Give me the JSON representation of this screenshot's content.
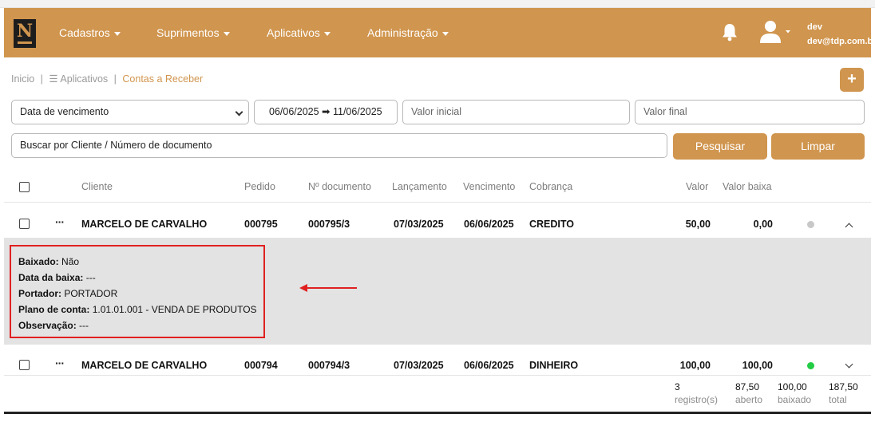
{
  "brand": {
    "logo_text": "N",
    "color": "#d0954e"
  },
  "nav": {
    "menus": [
      "Cadastros",
      "Suprimentos",
      "Aplicativos",
      "Administração"
    ],
    "user_name": "dev",
    "user_email": "dev@tdp.com.br",
    "icons": [
      "bell-icon",
      "user-icon"
    ]
  },
  "breadcrumb": {
    "home": "Inicio",
    "sep": "|",
    "menu_glyph": "☰",
    "apps": "Aplicativos",
    "current": "Contas a Receber",
    "add_label": "+"
  },
  "filters": {
    "date_type": "Data de vencimento",
    "date_range": "06/06/2025 ➡ 11/06/2025",
    "valor_inicial_placeholder": "Valor inicial",
    "valor_final_placeholder": "Valor final",
    "search_placeholder": "Buscar por Cliente / Número de documento",
    "search_button": "Pesquisar",
    "clear_button": "Limpar"
  },
  "table": {
    "headers": [
      "Cliente",
      "Pedido",
      "Nº documento",
      "Lançamento",
      "Vencimento",
      "Cobrança",
      "Valor",
      "Valor baixa"
    ],
    "rows": [
      {
        "menu": "···",
        "cliente": "MARCELO DE CARVALHO",
        "pedido": "000795",
        "documento": "000795/3",
        "lancamento": "07/03/2025",
        "vencimento": "06/06/2025",
        "cobranca": "CREDITO",
        "valor": "50,00",
        "valor_baixa": "0,00",
        "status_color": "#c8c8c8",
        "expanded": true
      },
      {
        "menu": "···",
        "cliente": "MARCELO DE CARVALHO",
        "pedido": "000794",
        "documento": "000794/3",
        "lancamento": "07/03/2025",
        "vencimento": "06/06/2025",
        "cobranca": "DINHEIRO",
        "valor": "100,00",
        "valor_baixa": "100,00",
        "status_color": "#22cc44",
        "expanded": false
      }
    ]
  },
  "details": {
    "baixado_label": "Baixado:",
    "baixado_value": "Não",
    "data_baixa_label": "Data da baixa:",
    "data_baixa_value": "---",
    "portador_label": "Portador:",
    "portador_value": "PORTADOR",
    "plano_label": "Plano de conta:",
    "plano_value": "1.01.01.001 - VENDA DE PRODUTOS",
    "observacao_label": "Observação:",
    "observacao_value": "---"
  },
  "summary": {
    "registros": "3",
    "registros_label": "registro(s)",
    "aberto": "87,50",
    "aberto_label": "aberto",
    "baixado": "100,00",
    "baixado_label": "baixado",
    "total": "187,50",
    "total_label": "total"
  },
  "annotation_color": "#e02020"
}
